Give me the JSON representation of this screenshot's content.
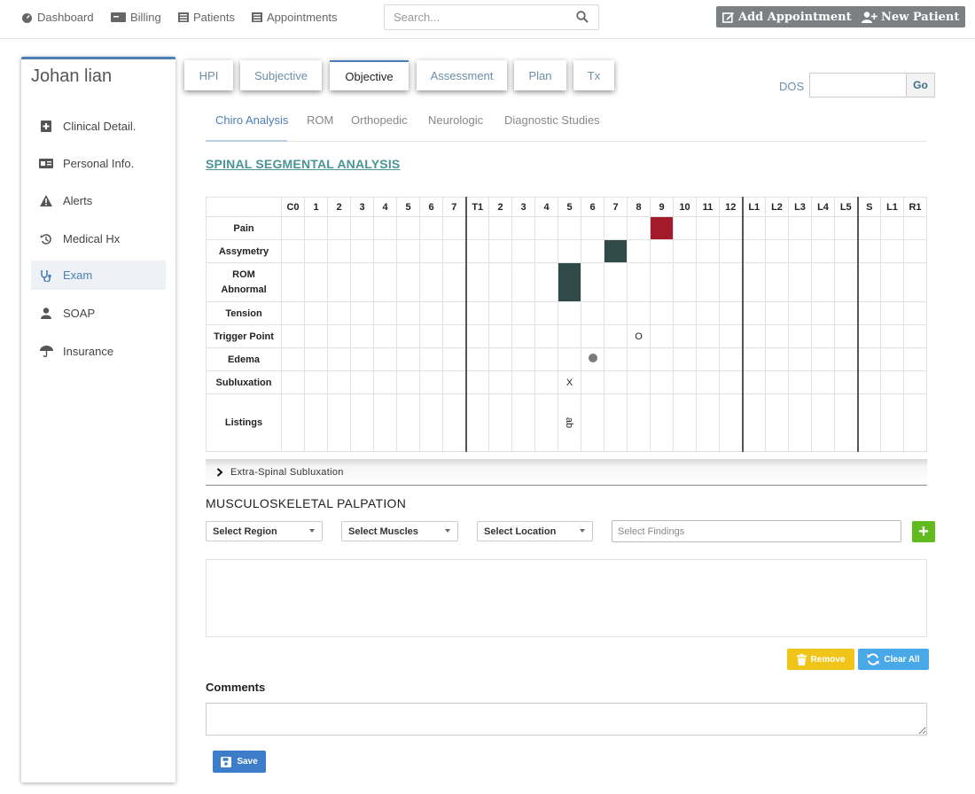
{
  "nav": {
    "dashboard": "Dashboard",
    "billing": "Billing",
    "patients": "Patients",
    "appointments": "Appointments",
    "search_placeholder": "Search...",
    "add_appointment": "Add Appointment",
    "new_patient": "New Patient"
  },
  "sidebar": {
    "patient_name": "Johan lian",
    "items": [
      {
        "label": "Clinical Detail.",
        "icon": "clinical-detail-icon"
      },
      {
        "label": "Personal Info.",
        "icon": "id-card-icon"
      },
      {
        "label": "Alerts",
        "icon": "warning-icon"
      },
      {
        "label": "Medical Hx",
        "icon": "history-icon"
      },
      {
        "label": "Exam",
        "icon": "stethoscope-icon"
      },
      {
        "label": "SOAP",
        "icon": "user-icon"
      },
      {
        "label": "Insurance",
        "icon": "umbrella-icon"
      }
    ],
    "active": "Exam"
  },
  "tabs": [
    "HPI",
    "Subjective",
    "Objective",
    "Assessment",
    "Plan",
    "Tx"
  ],
  "active_tab": "Objective",
  "dos": {
    "label": "DOS",
    "value": "",
    "go": "Go"
  },
  "subtabs": [
    "Chiro Analysis",
    "ROM",
    "Orthopedic",
    "Neurologic",
    "Diagnostic Studies"
  ],
  "active_subtab": "Chiro Analysis",
  "spinal": {
    "title": "SPINAL SEGMENTAL ANALYSIS",
    "columns": [
      "C0",
      "1",
      "2",
      "3",
      "4",
      "5",
      "6",
      "7",
      "T1",
      "2",
      "3",
      "4",
      "5",
      "6",
      "7",
      "8",
      "9",
      "10",
      "11",
      "12",
      "L1",
      "L2",
      "L3",
      "L4",
      "L5",
      "S",
      "L1",
      "R1"
    ],
    "rows": [
      {
        "label": "Pain",
        "marks": {
          "16": "red"
        }
      },
      {
        "label": "Assymetry",
        "marks": {
          "14": "dark"
        }
      },
      {
        "label": "ROM Abnormal",
        "marks": {
          "12": "dark"
        }
      },
      {
        "label": "Tension",
        "marks": {}
      },
      {
        "label": "Trigger Point",
        "marks": {
          "15": "text:O"
        }
      },
      {
        "label": "Edema",
        "marks": {
          "13": "dot"
        }
      },
      {
        "label": "Subluxation",
        "marks": {
          "12": "text:X"
        }
      },
      {
        "label": "Listings",
        "marks": {
          "12": "vtext:ab"
        }
      }
    ],
    "colors": {
      "red": "#a31a2a",
      "dark": "#2f4a48"
    }
  },
  "extra_spinal": "Extra-Spinal Subluxation",
  "palpation": {
    "title": "MUSCULOSKELETAL PALPATION",
    "region": "Select Region",
    "muscles": "Select Muscles",
    "location": "Select Location",
    "findings_placeholder": "Select Findings",
    "add": "+",
    "remove": "Remove",
    "clear_all": "Clear All"
  },
  "comments": {
    "label": "Comments",
    "value": ""
  },
  "save": "Save"
}
